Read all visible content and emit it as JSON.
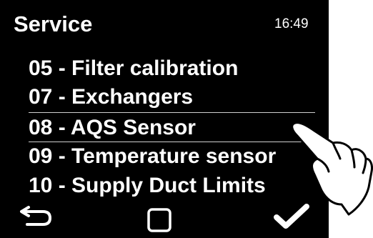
{
  "header": {
    "title": "Service",
    "time": "16:49"
  },
  "menu": {
    "items": [
      {
        "label": "05 - Filter calibration",
        "selected": false
      },
      {
        "label": "07 - Exchangers",
        "selected": false
      },
      {
        "label": "08 - AQS Sensor",
        "selected": true
      },
      {
        "label": "09 - Temperature sensor",
        "selected": false
      },
      {
        "label": "10 - Supply Duct Limits",
        "selected": false
      }
    ]
  },
  "footer": {
    "back_icon": "back-arrow-icon",
    "home_icon": "square-icon",
    "confirm_icon": "checkmark-icon"
  },
  "colors": {
    "screen_background": "#000000",
    "text": "#ffffff",
    "separator": "#cfcfcf"
  }
}
